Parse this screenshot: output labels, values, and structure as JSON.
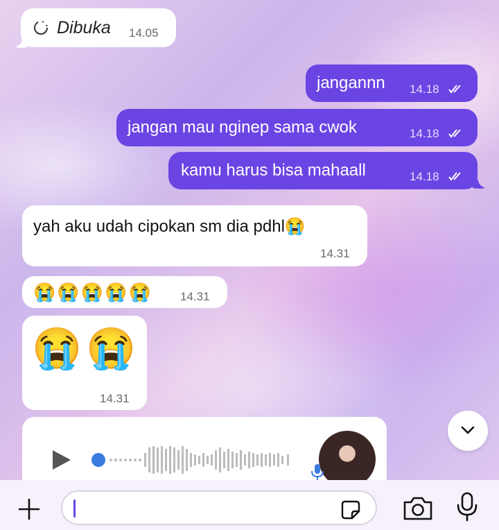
{
  "status_chip": {
    "label": "Dibuka",
    "time": "14.05",
    "icon": "loading-icon"
  },
  "messages": [
    {
      "dir": "out",
      "text": "jangannn",
      "time": "14.18",
      "status": "read-double-check-icon"
    },
    {
      "dir": "out",
      "text": "jangan mau nginep sama cwok",
      "time": "14.18",
      "status": "read-double-check-icon"
    },
    {
      "dir": "out",
      "text": "kamu harus bisa mahaall",
      "time": "14.18",
      "status": "read-double-check-icon"
    },
    {
      "dir": "in",
      "text": "yah aku udah cipokan sm dia pdhl😭",
      "time": "14.31"
    },
    {
      "dir": "in",
      "text": "😭😭😭😭😭",
      "time": "14.31"
    },
    {
      "dir": "in",
      "text": "😭😭",
      "time": "14.31"
    },
    {
      "dir": "in",
      "type": "voice-note",
      "icons": [
        "play-icon",
        "mic-icon",
        "avatar"
      ]
    }
  ],
  "composer": {
    "placeholder": "",
    "icons": [
      "plus-icon",
      "sticker-icon",
      "camera-icon",
      "mic-icon"
    ]
  },
  "colors": {
    "outgoing": "#6a45e3",
    "incoming": "#ffffff",
    "accent": "#6a45e3"
  }
}
